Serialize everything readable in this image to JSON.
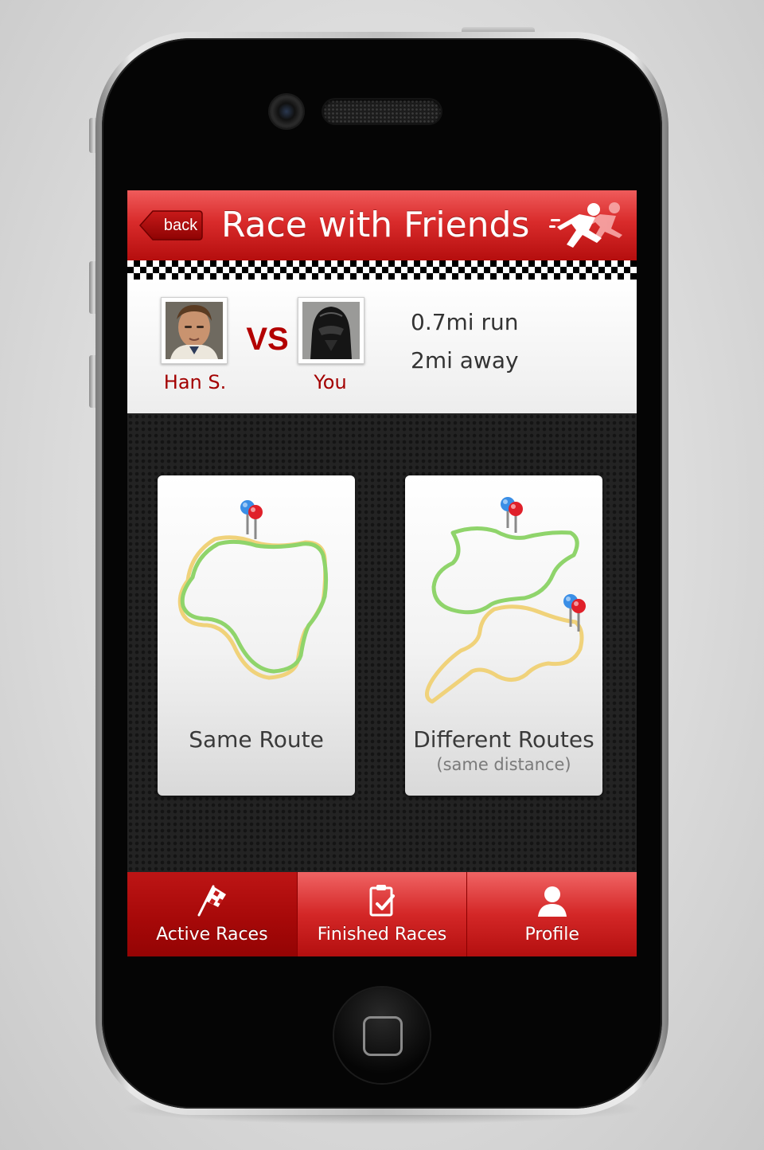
{
  "header": {
    "back_label": "back",
    "title": "Race with Friends",
    "logo_icon": "runner-icon"
  },
  "matchup": {
    "opponent": {
      "name": "Han S.",
      "avatar": "han-solo-avatar"
    },
    "vs_label": "VS",
    "player": {
      "name": "You",
      "avatar": "darth-vader-avatar"
    },
    "distance": "0.7mi run",
    "proximity": "2mi away"
  },
  "options": {
    "same_route": {
      "label": "Same Route",
      "icon": "same-route-map-icon"
    },
    "different_routes": {
      "label": "Different Routes",
      "sublabel": "(same distance)",
      "icon": "different-routes-map-icon"
    }
  },
  "tabs": [
    {
      "label": "Active Races",
      "icon": "checkered-flag-icon",
      "active": true
    },
    {
      "label": "Finished Races",
      "icon": "clipboard-check-icon",
      "active": false
    },
    {
      "label": "Profile",
      "icon": "person-icon",
      "active": false
    }
  ],
  "colors": {
    "brand_red": "#d92b2b",
    "accent_dark_red": "#a30000",
    "route_green": "#8fd46b",
    "route_yellow": "#f0d27a",
    "pin_blue": "#3a8ee6",
    "pin_red": "#e0202a"
  }
}
